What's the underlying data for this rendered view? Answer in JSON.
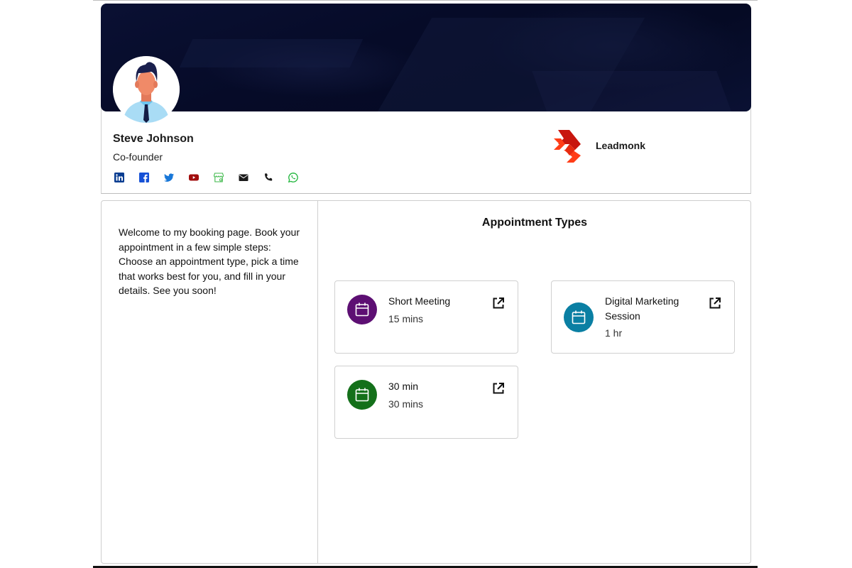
{
  "profile": {
    "name": "Steve Johnson",
    "role": "Co-founder",
    "socials": [
      {
        "icon": "linkedin-icon",
        "color": "#0a3d91"
      },
      {
        "icon": "facebook-icon",
        "color": "#1651d6"
      },
      {
        "icon": "twitter-icon",
        "color": "#1877d8"
      },
      {
        "icon": "youtube-icon",
        "color": "#a10d0d"
      },
      {
        "icon": "store-icon",
        "color": "#3fb94b"
      },
      {
        "icon": "email-icon",
        "color": "#1a1a1a"
      },
      {
        "icon": "phone-icon",
        "color": "#1a1a1a"
      },
      {
        "icon": "whatsapp-icon",
        "color": "#1fb53b"
      }
    ]
  },
  "brand": {
    "name": "Leadmonk",
    "colors": {
      "primary": "#c8160e",
      "secondary": "#ff3d17"
    }
  },
  "welcome_text": "Welcome to my booking page. Book your appointment in a few simple steps: Choose an appointment type, pick a time that works best for you, and fill in your details. See you soon!",
  "appointments": {
    "title": "Appointment Types",
    "items": [
      {
        "title": "Short Meeting",
        "duration": "15 mins",
        "color": "#5d0f73"
      },
      {
        "title": "Digital Marketing Session",
        "duration": "1 hr",
        "color": "#0a7fa3"
      },
      {
        "title": "30 min",
        "duration": "30 mins",
        "color": "#14701a"
      }
    ]
  }
}
